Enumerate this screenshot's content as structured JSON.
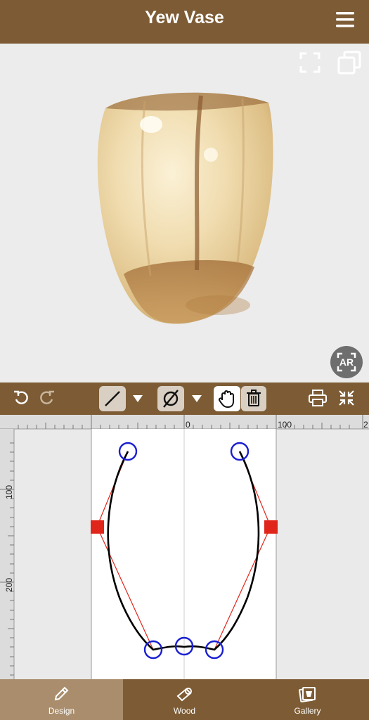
{
  "header": {
    "title": "Yew Vase",
    "menu_icon": "hamburger-icon"
  },
  "viewer": {
    "fullscreen_icon": "fullscreen-icon",
    "layers_icon": "layers-icon",
    "ar_label": "AR"
  },
  "toolbar": {
    "tools": [
      "undo-icon",
      "redo-icon",
      "line-tool-icon",
      "diameter-tool-icon",
      "hand-tool-icon",
      "trash-icon",
      "print-icon",
      "collapse-icon"
    ]
  },
  "editor": {
    "ruler_top_labels": [
      "0",
      "100",
      "2"
    ],
    "ruler_left_labels": [
      "100",
      "200"
    ]
  },
  "tabs": [
    {
      "label": "Design",
      "icon": "pencil-icon",
      "active": true
    },
    {
      "label": "Wood",
      "icon": "log-icon",
      "active": false
    },
    {
      "label": "Gallery",
      "icon": "gallery-icon",
      "active": false
    }
  ],
  "colors": {
    "brown": "#7d5c35",
    "tab_active": "#a98d6c",
    "control_point": "#1a1fd1",
    "handle": "#e0261b"
  }
}
